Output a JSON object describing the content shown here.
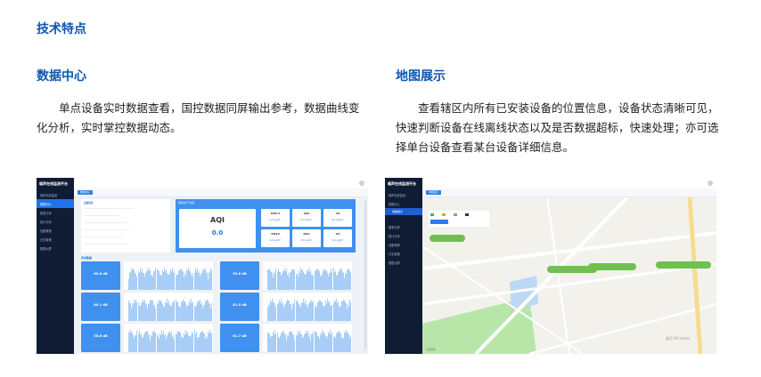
{
  "section_title": "技术特点",
  "left": {
    "heading": "数据中心",
    "text": "单点设备实时数据查看，国控数据同屏输出参考，数据曲线变化分析，实时掌控数据动态。",
    "screenshot": {
      "app_title": "噪声在线监测平台",
      "menu": [
        "噪声在线监测",
        "数据中心",
        "报表分析",
        "统计分析",
        "设备管理",
        "日志管理",
        "数据大屏"
      ],
      "tab_label": "数据中心",
      "device_info_title": "设备信息",
      "aqi_title": "国控站空气质量",
      "aqi_label": "AQI",
      "aqi_value": "0.0",
      "pollutants": [
        {
          "name": "PM2.5",
          "value": "0.0 ug/m³"
        },
        {
          "name": "SO2",
          "value": "0.0 ug/m³"
        },
        {
          "name": "CO",
          "value": "0.0 mg/m³"
        },
        {
          "name": "PM10",
          "value": "0.0 ug/m³"
        },
        {
          "name": "NO2",
          "value": "0.0 ug/m³"
        },
        {
          "name": "O3",
          "value": "0.0 ug/m³"
        }
      ],
      "realtime_title": "实时数据",
      "readings": [
        "63.6 dB",
        "59.8 dB",
        "60.1 dB",
        "61.5 dB",
        "58.6 dB",
        "61.7 dB"
      ]
    }
  },
  "right": {
    "heading": "地图展示",
    "text": "查看辖区内所有已安装设备的位置信息，设备状态清晰可见，快速判断设备在线离线状态以及是否数据超标，快速处理；亦可选择单台设备查看某台设备详细信息。",
    "screenshot": {
      "app_title": "噪声在线监测平台",
      "menu": [
        "噪声在线监测",
        "数据中心",
        "报表分析",
        "统计分析",
        "设备管理",
        "日志管理",
        "数据大屏"
      ],
      "active_sub": "地图展示",
      "tab_label": "地图展示",
      "map_watermark": "激活 Windows",
      "map_attribution": "高德地图"
    }
  }
}
